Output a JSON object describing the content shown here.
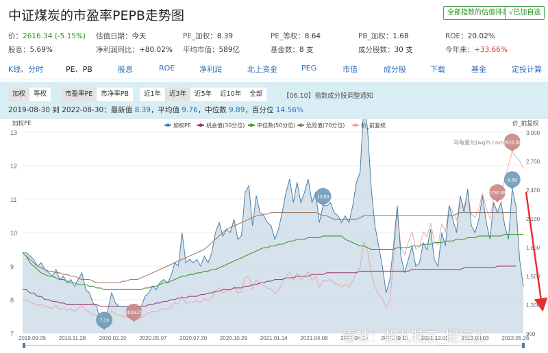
{
  "header": {
    "title": "中证煤炭的市盈率PEPB走势图",
    "rank_button": "全部指数的估值排名",
    "watch_button": "√已加自选"
  },
  "stats": {
    "price_label": "价：",
    "price_value": "2616.34 (-5.15%)",
    "val_date_label": "估值日期：",
    "val_date_value": "今天",
    "pe_w_label": "PE_加权：",
    "pe_w_value": "8.39",
    "pe_eq_label": "PE_等权：",
    "pe_eq_value": "8.64",
    "pb_w_label": "PB_加权：",
    "pb_w_value": "1.68",
    "roe_label": "ROE：",
    "roe_value": "20.02%",
    "div_label": "股息：",
    "div_value": "5.69%",
    "np_label": "净利润同比：",
    "np_value": "+80.02%",
    "mcap_label": "平均市值：",
    "mcap_value": "589亿",
    "funds_label": "基金数：",
    "funds_value": "8 支",
    "cons_label": "成分股数：",
    "cons_value": "30 支",
    "ytd_label": "今年来：",
    "ytd_value": "+33.66%"
  },
  "nav": [
    "K线、分时",
    "PE、PB",
    "股息",
    "ROE",
    "净利润",
    "北上资金",
    "PEG",
    "市值",
    "成分股",
    "下载",
    "基金",
    "定投计算"
  ],
  "controls": {
    "weight": [
      "加权",
      "等权"
    ],
    "metric": [
      "市盈率PE",
      "市净率PB"
    ],
    "range": [
      "近1年",
      "近3年",
      "近5年",
      "近10年",
      "全部"
    ],
    "notice": "【06.10】指数成分股调整通知",
    "summary_prefix": "2019-08-30 到 2022-08-30：最新值",
    "latest": "8.39",
    "avg_label": "，平均值",
    "avg": "9.76",
    "median_label": "，中位数",
    "median": "9.89",
    "pct_label": "，百分位",
    "pct": "14.56%"
  },
  "watermark": "雪球：朝九晚五_搬运工",
  "chart_data": {
    "type": "line",
    "ylabel": "加权PE",
    "y2label": "价_前复权",
    "source": "乌龟量化(wglh.com)",
    "ylim": [
      7,
      13
    ],
    "y2lim": [
      900,
      3000
    ],
    "yticks": [
      7,
      8,
      9,
      10,
      11,
      12,
      13
    ],
    "y2ticks": [
      "900",
      "1,200",
      "1,500",
      "1,800",
      "2,100",
      "2,400",
      "2,700",
      "3,000"
    ],
    "y2tick_values": [
      900,
      1200,
      1500,
      1800,
      2100,
      2400,
      2700,
      3000
    ],
    "xticks": [
      "2019.09.05",
      "2019.11.28",
      "2020.02.20",
      "2020.05.07",
      "2020.07.30",
      "2020.10.29",
      "2021.01.14",
      "2021.04.08",
      "2021.06.24",
      "2021.09.15",
      "2021.12.08",
      "2022.03.03",
      "2022.05.26"
    ],
    "legend": [
      "加权PE",
      "机会值(30分位)",
      "中位数(50分位)",
      "危险值(70分位)",
      "价_前复权"
    ],
    "colors": {
      "pe": "#4a7fa8",
      "pe_fill": "#cfdde9",
      "opportunity": "#9a2f6b",
      "median": "#3e9a2a",
      "danger": "#9a7052",
      "price": "#e6a3a3",
      "pin_blue": "#6f9ab9",
      "pin_red": "#c88787",
      "arrow": "#e53030"
    },
    "markers": [
      {
        "label": "13.83",
        "series": "pe",
        "x_index": 81
      },
      {
        "label": "7.13",
        "series": "pe",
        "x_index": 22
      },
      {
        "label": "8.39",
        "series": "pe",
        "x_index": 132
      },
      {
        "label": "1029.21",
        "series": "price",
        "x_index": 30
      },
      {
        "label": "2797.88",
        "series": "price",
        "x_index": 128
      },
      {
        "label": "2616.34",
        "series": "price",
        "x_index": 132
      }
    ],
    "series": {
      "pe": [
        9.4,
        9.4,
        9.3,
        9.2,
        9.0,
        9.1,
        8.9,
        8.8,
        8.7,
        8.9,
        8.6,
        8.7,
        8.5,
        8.6,
        8.4,
        8.6,
        8.8,
        8.3,
        8.2,
        7.9,
        7.8,
        7.3,
        7.13,
        7.7,
        8.2,
        7.9,
        7.8,
        7.8,
        7.8,
        7.8,
        7.7,
        7.75,
        7.8,
        8.1,
        8.2,
        8.4,
        8.3,
        8.5,
        8.6,
        8.5,
        8.7,
        9.1,
        9.0,
        10.0,
        9.1,
        9.2,
        9.1,
        9.2,
        9.0,
        9.3,
        9.1,
        9.4,
        10.0,
        10.3,
        9.9,
        10.1,
        10.0,
        10.4,
        9.8,
        9.9,
        11.2,
        11.4,
        10.2,
        11.1,
        10.6,
        10.5,
        10.3,
        10.2,
        9.8,
        10.1,
        10.6,
        11.2,
        11.6,
        10.9,
        11.5,
        10.9,
        11.2,
        11.6,
        10.9,
        11.2,
        10.3,
        10.8,
        10.8,
        10.9,
        10.6,
        10.5,
        10.3,
        10.5,
        10.3,
        10.8,
        11.5,
        11.8,
        13.83,
        13.1,
        11.3,
        10.2,
        9.6,
        9.0,
        8.2,
        8.6,
        9.6,
        10.8,
        9.3,
        8.8,
        9.2,
        9.6,
        9.0,
        9.1,
        9.7,
        9.5,
        10.1,
        9.2,
        9.0,
        10.0,
        9.6,
        10.8,
        10.4,
        10.0,
        11.1,
        10.6,
        11.3,
        10.2,
        10.0,
        10.4,
        11.1,
        10.3,
        9.8,
        10.9,
        10.6,
        10.9,
        10.2,
        9.8,
        11.3,
        10.8,
        9.2,
        8.39
      ],
      "opportunity": [
        8.3,
        8.3,
        8.2,
        8.2,
        8.1,
        8.1,
        8.0,
        8.0,
        7.95,
        7.95,
        7.9,
        7.9,
        7.85,
        7.85,
        7.85,
        7.85,
        7.85,
        7.85,
        7.85,
        7.85,
        7.85,
        7.8,
        7.8,
        7.8,
        7.8,
        7.8,
        7.8,
        7.8,
        7.8,
        7.8,
        7.8,
        7.8,
        7.8,
        7.8,
        7.85,
        7.85,
        7.9,
        7.9,
        7.95,
        7.95,
        8.0,
        8.0,
        8.05,
        8.05,
        8.05,
        8.1,
        8.1,
        8.1,
        8.15,
        8.15,
        8.2,
        8.2,
        8.25,
        8.25,
        8.3,
        8.3,
        8.3,
        8.35,
        8.35,
        8.35,
        8.4,
        8.4,
        8.45,
        8.45,
        8.5,
        8.5,
        8.55,
        8.55,
        8.6,
        8.6,
        8.6,
        8.65,
        8.65,
        8.65,
        8.7,
        8.7,
        8.7,
        8.7,
        8.75,
        8.75,
        8.75,
        8.75,
        8.8,
        8.8,
        8.8,
        8.8,
        8.8,
        8.8,
        8.8,
        8.8,
        8.8,
        8.85,
        8.85,
        8.85,
        8.85,
        8.85,
        8.85,
        8.85,
        8.85,
        8.85,
        8.85,
        8.85,
        8.85,
        8.85,
        8.85,
        8.9,
        8.9,
        8.9,
        8.9,
        8.9,
        8.9,
        8.9,
        8.9,
        8.9,
        8.9,
        8.9,
        8.9,
        8.9,
        8.9,
        8.95,
        8.95,
        8.95,
        8.95,
        8.95,
        8.95,
        8.95,
        8.95,
        8.95,
        9.0,
        9.0,
        9.0,
        9.0,
        9.0,
        9.0
      ],
      "median": [
        9.4,
        9.3,
        9.1,
        9.0,
        8.9,
        8.8,
        8.75,
        8.7,
        8.7,
        8.65,
        8.6,
        8.6,
        8.55,
        8.5,
        8.5,
        8.45,
        8.45,
        8.45,
        8.4,
        8.4,
        8.35,
        8.35,
        8.3,
        8.3,
        8.3,
        8.3,
        8.3,
        8.3,
        8.3,
        8.3,
        8.3,
        8.3,
        8.3,
        8.35,
        8.35,
        8.4,
        8.4,
        8.45,
        8.5,
        8.5,
        8.55,
        8.6,
        8.65,
        8.7,
        8.7,
        8.75,
        8.75,
        8.8,
        8.8,
        8.85,
        8.85,
        8.9,
        8.9,
        8.95,
        9.0,
        9.05,
        9.1,
        9.15,
        9.2,
        9.25,
        9.3,
        9.35,
        9.4,
        9.45,
        9.5,
        9.55,
        9.55,
        9.6,
        9.6,
        9.65,
        9.65,
        9.7,
        9.75,
        9.75,
        9.8,
        9.8,
        9.8,
        9.85,
        9.85,
        9.85,
        9.85,
        9.9,
        9.9,
        9.9,
        9.9,
        9.9,
        9.9,
        9.8,
        9.75,
        9.7,
        9.65,
        9.6,
        9.6,
        9.55,
        9.5,
        9.5,
        9.5,
        9.5,
        9.5,
        9.5,
        9.5,
        9.55,
        9.55,
        9.55,
        9.55,
        9.6,
        9.6,
        9.6,
        9.65,
        9.65,
        9.65,
        9.7,
        9.7,
        9.7,
        9.75,
        9.75,
        9.75,
        9.8,
        9.8,
        9.8,
        9.85,
        9.85,
        9.85,
        9.9,
        9.9,
        9.9,
        9.9,
        9.9,
        9.9,
        9.9,
        9.95,
        9.95,
        9.95,
        9.95,
        9.95,
        9.95
      ],
      "danger": [
        9.4,
        9.3,
        9.2,
        9.1,
        9.0,
        8.95,
        8.9,
        8.85,
        8.85,
        8.8,
        8.8,
        8.75,
        8.75,
        8.7,
        8.7,
        8.65,
        8.6,
        8.6,
        8.6,
        8.55,
        8.5,
        8.5,
        8.5,
        8.5,
        8.5,
        8.5,
        8.5,
        8.55,
        8.55,
        8.6,
        8.6,
        8.6,
        8.65,
        8.7,
        8.75,
        8.8,
        8.85,
        8.9,
        8.95,
        9.0,
        9.05,
        9.1,
        9.15,
        9.2,
        9.25,
        9.3,
        9.35,
        9.4,
        9.45,
        9.5,
        9.6,
        9.7,
        9.8,
        9.9,
        10.0,
        10.1,
        10.15,
        10.2,
        10.25,
        10.3,
        10.35,
        10.4,
        10.45,
        10.5,
        10.5,
        10.55,
        10.55,
        10.6,
        10.6,
        10.6,
        10.6,
        10.6,
        10.6,
        10.6,
        10.6,
        10.6,
        10.6,
        10.6,
        10.6,
        10.6,
        10.55,
        10.5,
        10.5,
        10.45,
        10.4,
        10.4,
        10.4,
        10.4,
        10.4,
        10.4,
        10.4,
        10.45,
        10.5,
        10.5,
        10.5,
        10.5,
        10.5,
        10.5,
        10.5,
        10.5,
        10.5,
        10.5,
        10.5,
        10.5,
        10.5,
        10.5,
        10.5,
        10.5,
        10.5,
        10.5,
        10.5,
        10.5,
        10.5,
        10.5,
        10.5,
        10.5,
        10.5,
        10.55,
        10.6,
        10.6,
        10.6,
        10.6,
        10.6,
        10.6,
        10.6,
        10.6,
        10.6,
        10.6,
        10.6,
        10.6,
        10.6,
        10.6,
        10.6,
        10.6
      ],
      "price": [
        1240,
        1250,
        1220,
        1210,
        1190,
        1200,
        1180,
        1170,
        1160,
        1190,
        1150,
        1160,
        1140,
        1150,
        1130,
        1160,
        1190,
        1140,
        1120,
        1090,
        1080,
        1050,
        1040,
        1070,
        1130,
        1100,
        1090,
        1080,
        1070,
        1060,
        1029,
        1040,
        1060,
        1090,
        1110,
        1130,
        1120,
        1140,
        1160,
        1150,
        1170,
        1220,
        1200,
        1290,
        1210,
        1230,
        1220,
        1240,
        1220,
        1260,
        1240,
        1270,
        1330,
        1370,
        1320,
        1350,
        1340,
        1390,
        1320,
        1330,
        1480,
        1500,
        1360,
        1460,
        1410,
        1400,
        1370,
        1360,
        1310,
        1350,
        1420,
        1490,
        1540,
        1450,
        1530,
        1450,
        1490,
        1540,
        1450,
        1490,
        1380,
        1450,
        1450,
        1460,
        1420,
        1410,
        1380,
        1410,
        1380,
        1450,
        1540,
        1580,
        1850,
        1760,
        1520,
        1380,
        1310,
        1260,
        1170,
        1230,
        1660,
        2160,
        1800,
        1720,
        1850,
        1960,
        1780,
        1800,
        1960,
        1900,
        2050,
        1860,
        1820,
        2040,
        1960,
        2230,
        2160,
        2080,
        2320,
        2210,
        2370,
        2140,
        2110,
        2200,
        2360,
        2200,
        2090,
        2330,
        2270,
        2360,
        2500,
        2660,
        2797.88,
        2740,
        2700,
        2616.34
      ]
    }
  }
}
